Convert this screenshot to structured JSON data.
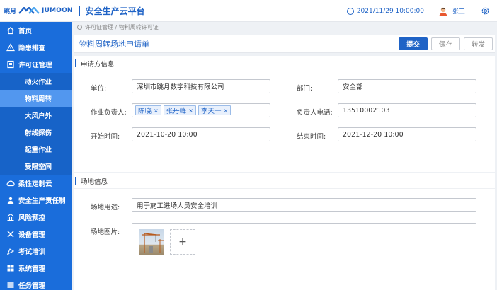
{
  "header": {
    "logo_cn": "跳月",
    "logo_en": "JUMOON",
    "app_title": "安全生产云平台",
    "datetime": "2021/11/29  10:00:00",
    "username": "张三",
    "brand_color": "#1f63c6"
  },
  "sidebar": {
    "items": [
      {
        "label": "首页",
        "icon": "home-icon"
      },
      {
        "label": "隐患排查",
        "icon": "warning-icon"
      },
      {
        "label": "许可证管理",
        "icon": "document-icon"
      }
    ],
    "sub_items": [
      {
        "label": "动火作业"
      },
      {
        "label": "物料周转"
      },
      {
        "label": "大风户外"
      },
      {
        "label": "射线探伤"
      },
      {
        "label": "起重作业"
      },
      {
        "label": "受限空间"
      }
    ],
    "lower_items": [
      {
        "label": "柔性定制云",
        "icon": "cloud-icon"
      },
      {
        "label": "安全生产责任制",
        "icon": "person-group-icon"
      },
      {
        "label": "风险预控",
        "icon": "building-icon"
      },
      {
        "label": "设备管理",
        "icon": "tools-icon"
      },
      {
        "label": "考试培训",
        "icon": "graduation-icon"
      },
      {
        "label": "系统管理",
        "icon": "grid-icon"
      },
      {
        "label": "任务管理",
        "icon": "list-icon"
      }
    ],
    "active_sub": "物料周转",
    "bg_color": "#1a6ddb"
  },
  "breadcrumb": {
    "path": "许可证管理 / 物料周转许可证"
  },
  "page": {
    "title": "物料周转场地申请单",
    "submit_label": "提交",
    "save_label": "保存",
    "forward_label": "转发"
  },
  "applicant": {
    "section_title": "申请方信息",
    "unit_label": "单位:",
    "unit_value": "深圳市跳月数字科技有限公司",
    "dept_label": "部门:",
    "dept_value": "安全部",
    "owner_label": "作业负责人:",
    "owners": [
      "陈晓",
      "张丹峰",
      "李天一"
    ],
    "phone_label": "负责人电话:",
    "phone_value": "13510002103",
    "start_label": "开始时间:",
    "start_value": "2021-10-20  10:00",
    "end_label": "结束时间:",
    "end_value": "2021-12-20  10:00"
  },
  "site": {
    "section_title": "场地信息",
    "usage_label": "场地用途:",
    "usage_value": "用于施工进场人员安全培训",
    "image_label": "场地图片:",
    "add_symbol": "+"
  }
}
